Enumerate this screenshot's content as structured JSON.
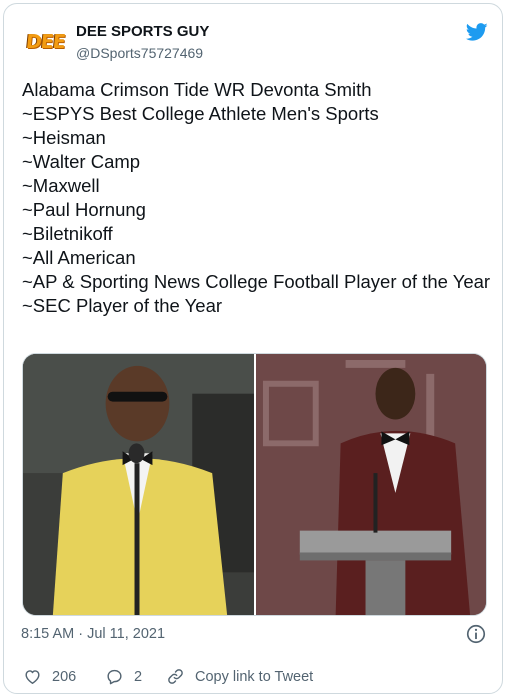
{
  "author": {
    "display_name": "DEE SPORTS GUY",
    "handle": "@DSports75727469",
    "avatar_text": "DEE"
  },
  "tweet": {
    "text": "Alabama Crimson Tide WR Devonta Smith\n~ESPYS Best College Athlete Men's Sports\n~Heisman\n~Walter Camp\n~Maxwell\n~Paul Hornung\n~Biletnikoff\n~All American\n~AP & Sporting News College Football Player of the Year\n~SEC Player of the Year",
    "timestamp": "8:15 AM · Jul 11, 2021"
  },
  "actions": {
    "likes": "206",
    "replies": "2",
    "copy_link_label": "Copy link to Tweet"
  },
  "icons": {
    "brand": "twitter-bird-icon",
    "info": "info-icon",
    "like": "heart-icon",
    "reply": "reply-bubble-icon",
    "link": "link-icon"
  },
  "colors": {
    "twitter_blue": "#1d9bf0",
    "secondary_text": "#536471",
    "border": "#cfd9de"
  }
}
